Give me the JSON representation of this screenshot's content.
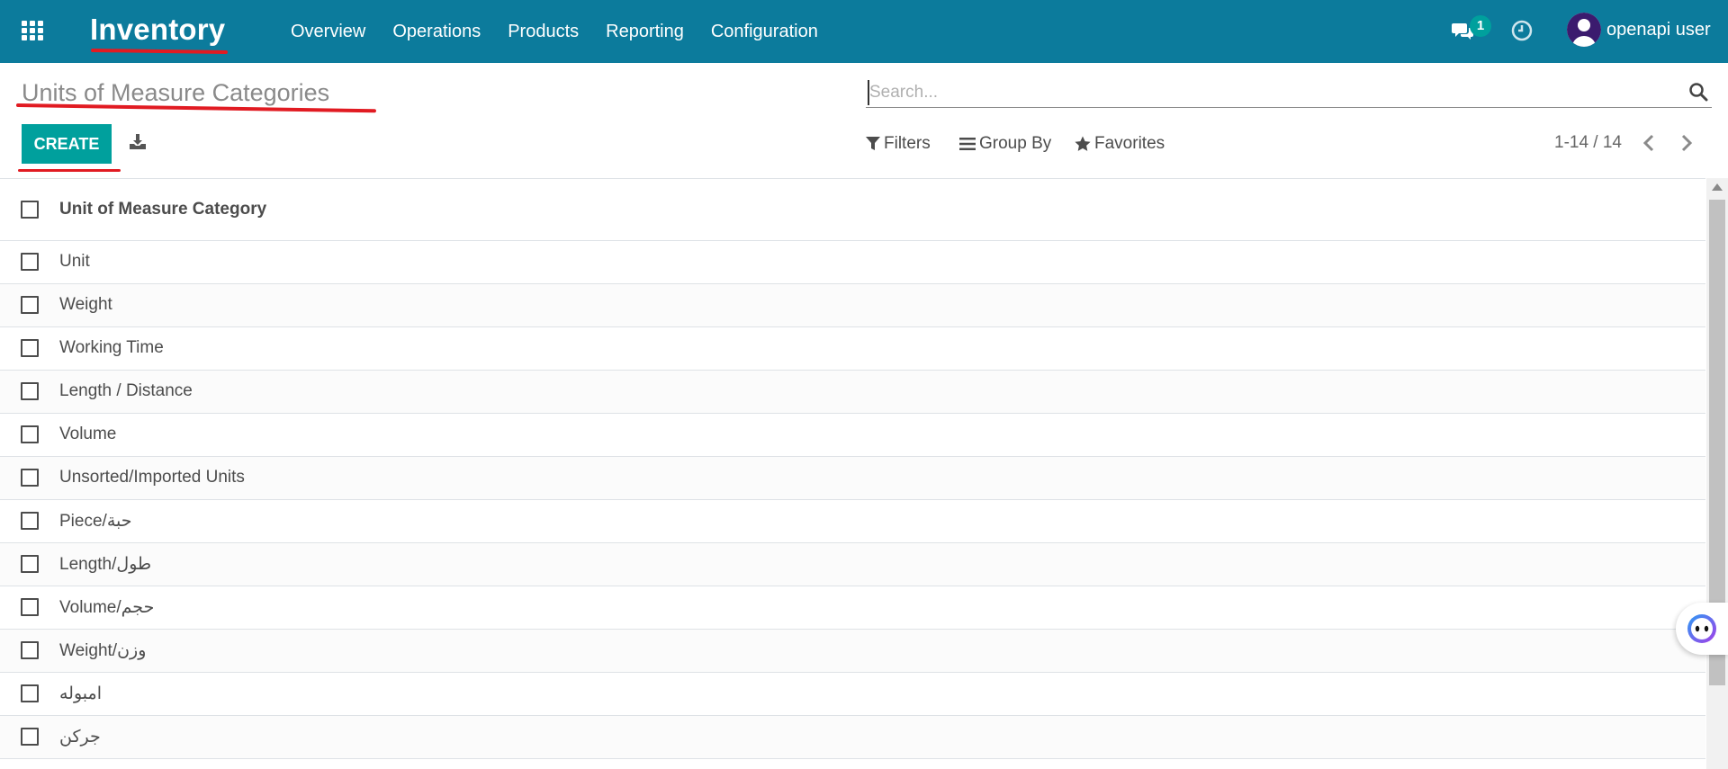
{
  "navbar": {
    "app_title": "Inventory",
    "menu": [
      "Overview",
      "Operations",
      "Products",
      "Reporting",
      "Configuration"
    ],
    "chat_badge": "1",
    "user_name": "openapi user"
  },
  "control_panel": {
    "breadcrumb": "Units of Measure Categories",
    "create_label": "CREATE",
    "search_placeholder": "Search...",
    "filters_label": "Filters",
    "group_by_label": "Group By",
    "favorites_label": "Favorites",
    "pager_value": "1-14 / 14"
  },
  "list": {
    "column_header": "Unit of Measure Category",
    "rows": [
      "Unit",
      "Weight",
      "Working Time",
      "Length / Distance",
      "Volume",
      "Unsorted/Imported Units",
      "Piece/حبة",
      "Length/طول",
      "Volume/حجم",
      "Weight/وزن",
      "امبوله",
      "جركن"
    ]
  },
  "colors": {
    "navbar": "#0c7b9c",
    "primary_button": "#00a09d",
    "annotation_underline": "#e11b22"
  },
  "icons": [
    "apps-grid-icon",
    "chat-icon",
    "clock-icon",
    "user-avatar-icon",
    "download-icon",
    "search-icon",
    "filter-icon",
    "group-by-icon",
    "star-icon",
    "chevron-left-icon",
    "chevron-right-icon",
    "bot-assistant-icon"
  ]
}
